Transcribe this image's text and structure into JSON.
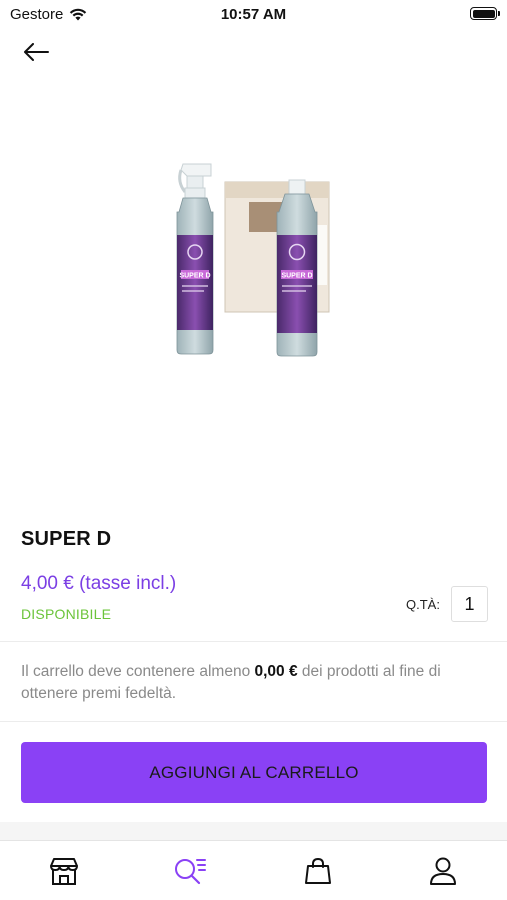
{
  "status_bar": {
    "carrier": "Gestore",
    "time": "10:57 AM"
  },
  "product": {
    "title": "SUPER D",
    "price": "4,00 € (tasse incl.)",
    "availability": "DISPONIBILE",
    "image_label": "SUPER D"
  },
  "quantity": {
    "label": "Q.TÀ:",
    "value": "1"
  },
  "loyalty": {
    "prefix": "Il carrello deve contenere almeno ",
    "amount": "0,00 €",
    "suffix": " dei prodotti al fine di ottenere premi fedeltà."
  },
  "actions": {
    "add_to_cart": "AGGIUNGI AL CARRELLO"
  },
  "colors": {
    "accent": "#8a41f5",
    "price": "#7b3fe4",
    "available": "#6bc43a"
  },
  "tabs": [
    {
      "icon": "store-icon",
      "active": false
    },
    {
      "icon": "search-list-icon",
      "active": true
    },
    {
      "icon": "shopping-bag-icon",
      "active": false
    },
    {
      "icon": "user-icon",
      "active": false
    }
  ]
}
